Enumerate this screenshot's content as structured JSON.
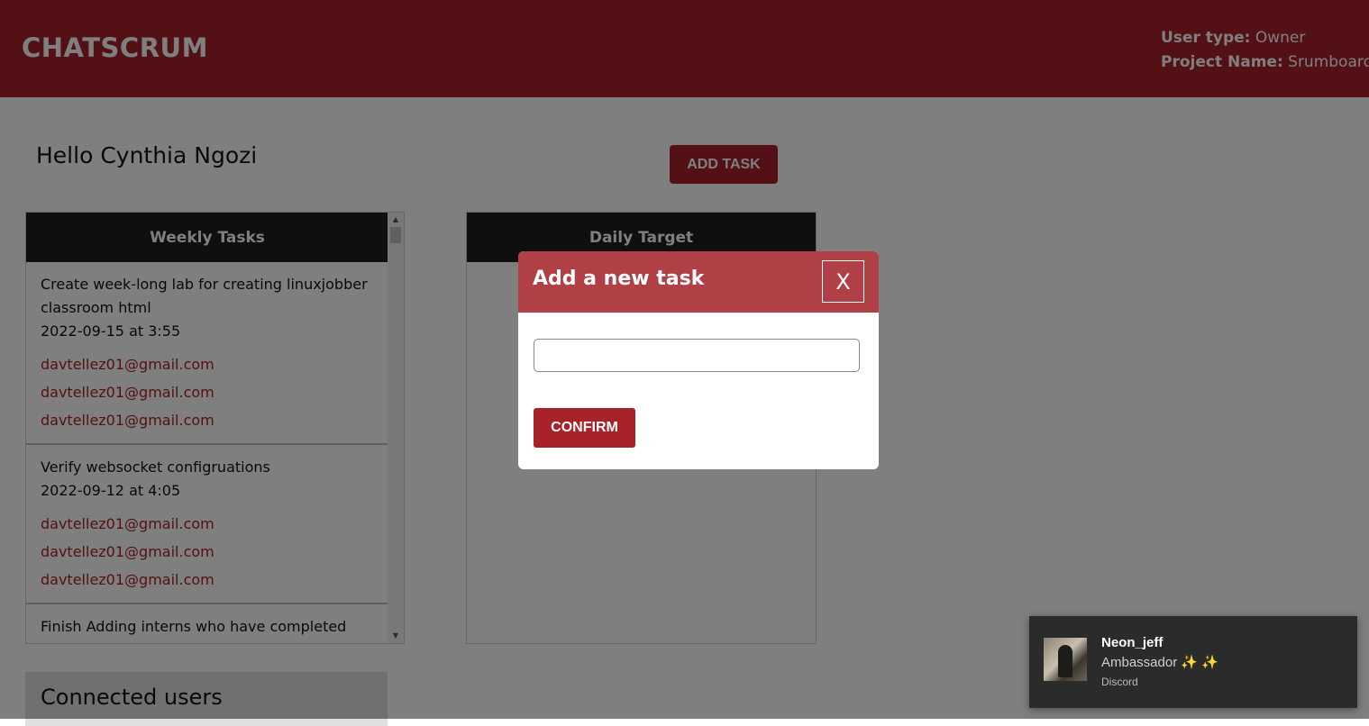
{
  "header": {
    "brand": "CHATSCRUM",
    "user_type_label": "User type:",
    "user_type_value": "Owner",
    "project_name_label": "Project Name:",
    "project_name_value": "Srumboard"
  },
  "main": {
    "greeting": "Hello Cynthia Ngozi",
    "add_task_label": "ADD TASK",
    "weekly": {
      "title": "Weekly Tasks",
      "tasks": [
        {
          "title": "Create week-long lab for creating linuxjobber classroom html",
          "date": "2022-09-15 at 3:55",
          "emails": [
            "davtellez01@gmail.com",
            "davtellez01@gmail.com",
            "davtellez01@gmail.com"
          ]
        },
        {
          "title": "Verify websocket configruations",
          "date": "2022-09-12 at 4:05",
          "emails": [
            "davtellez01@gmail.com",
            "davtellez01@gmail.com",
            "davtellez01@gmail.com"
          ]
        },
        {
          "title": "Finish Adding interns who have completed"
        }
      ]
    },
    "daily": {
      "title": "Daily Target"
    },
    "connected_users_title": "Connected users"
  },
  "modal": {
    "title": "Add a new task",
    "close_label": "X",
    "input_value": "",
    "input_placeholder": "",
    "confirm_label": "CONFIRM"
  },
  "toast": {
    "name": "Neon_jeff",
    "role": "Ambassador ✨ ✨",
    "source": "Discord"
  },
  "colors": {
    "brand": "#a8222a",
    "modal_header": "#b04046",
    "panel_header": "#1f1f1f"
  }
}
